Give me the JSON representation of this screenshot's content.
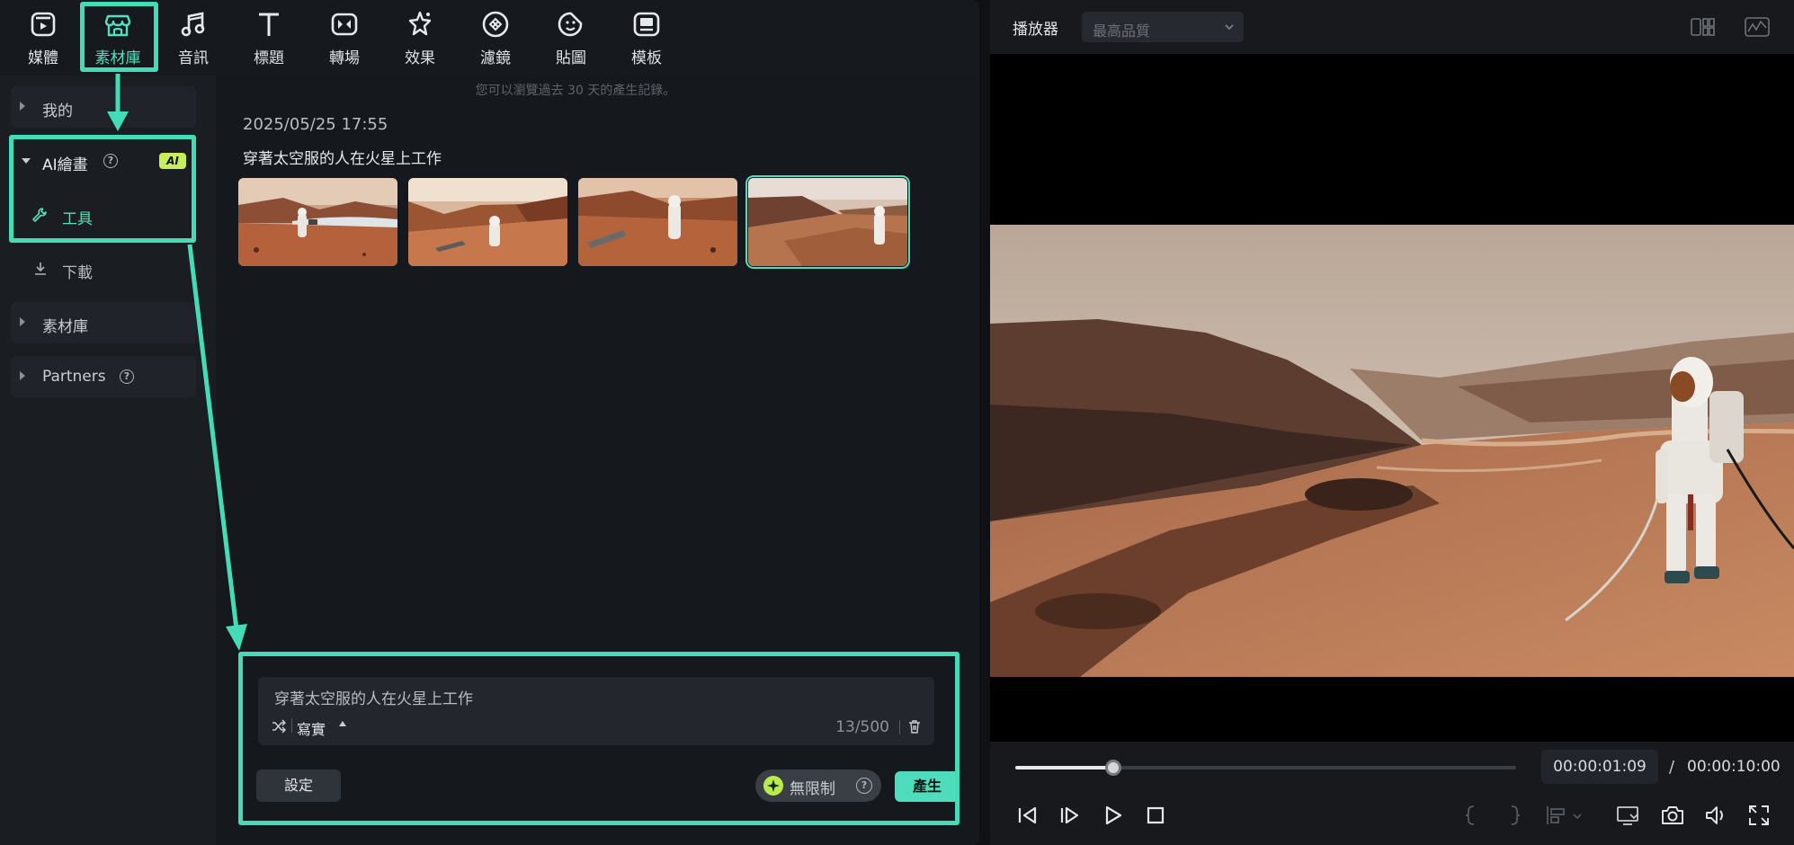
{
  "toolbar": {
    "items": [
      {
        "label": "媒體",
        "icon": "media-icon"
      },
      {
        "label": "素材庫",
        "icon": "store-icon"
      },
      {
        "label": "音訊",
        "icon": "music-note-icon"
      },
      {
        "label": "標題",
        "icon": "title-t-icon"
      },
      {
        "label": "轉場",
        "icon": "transition-icon"
      },
      {
        "label": "效果",
        "icon": "effects-sparkle-icon"
      },
      {
        "label": "濾鏡",
        "icon": "filter-icon"
      },
      {
        "label": "貼圖",
        "icon": "sticker-icon"
      },
      {
        "label": "模板",
        "icon": "template-icon"
      }
    ],
    "active_index": 1
  },
  "sidebar": {
    "mine": "我的",
    "ai_painting": "AI繪畫",
    "ai_badge": "AI",
    "tools": "工具",
    "download": "下載",
    "library": "素材庫",
    "partners": "Partners"
  },
  "content": {
    "hint": "您可以瀏覽過去 30 天的產生記錄。",
    "date": "2025/05/25 17:55",
    "prompt_title": "穿著太空服的人在火星上工作",
    "selected_thumb": 4
  },
  "prompt": {
    "text": "穿著太空服的人在火星上工作",
    "style": "寫實",
    "counter": "13/500",
    "settings_label": "設定",
    "unlimited_label": "無限制",
    "generate_label": "產生"
  },
  "player": {
    "title": "播放器",
    "quality": "最高品質",
    "progress": 0.196,
    "current_time": "00:00:01:09",
    "separator": "/",
    "total_time": "00:00:10:00"
  },
  "colors": {
    "accent": "#4fdcbc",
    "annotation": "#44dcb6",
    "ai_badge": "#c6f05a"
  }
}
